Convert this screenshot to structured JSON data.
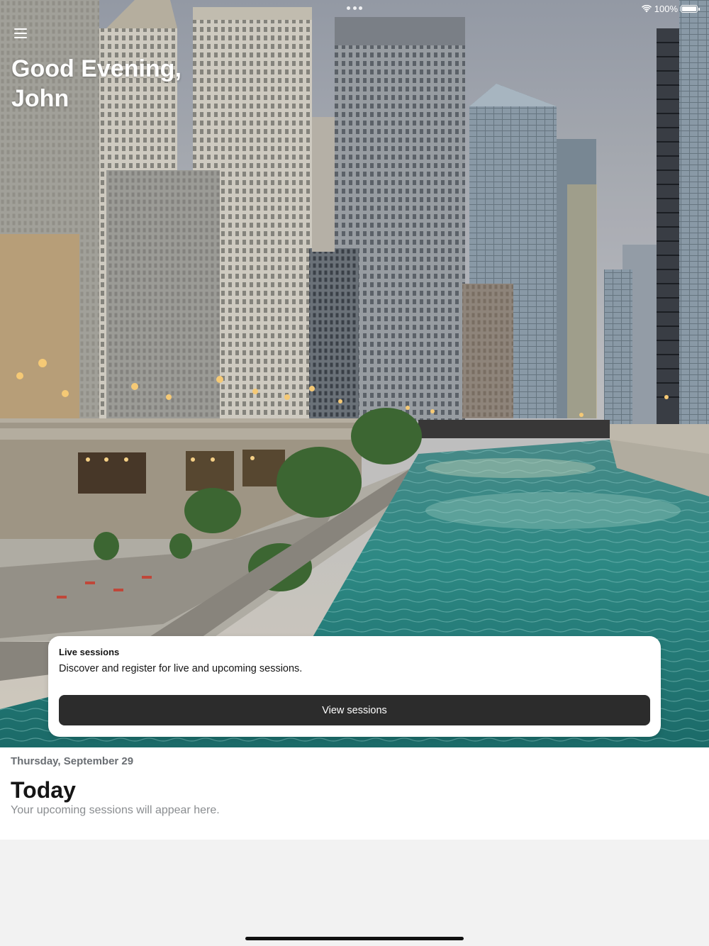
{
  "status_bar": {
    "battery": "100%",
    "battery_level": 1.0
  },
  "header": {
    "greeting": "Good Evening, John"
  },
  "live_sessions": {
    "title": "Live sessions",
    "description": "Discover and register for live and upcoming sessions.",
    "button_label": "View sessions"
  },
  "today": {
    "date": "Thursday, September 29",
    "title": "Today",
    "empty_message": "Your upcoming sessions will appear here."
  },
  "colors": {
    "button_bg": "#2c2c2c",
    "page_bg": "#f2f2f2",
    "river": "#2f8f8a",
    "sky": "#b9bcc4"
  }
}
